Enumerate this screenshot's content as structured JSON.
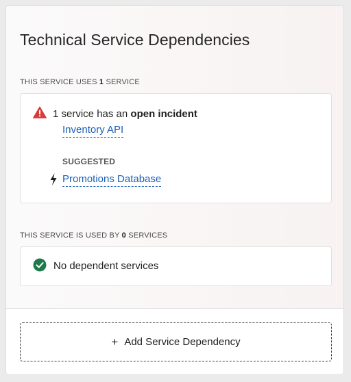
{
  "card": {
    "title": "Technical Service Dependencies"
  },
  "uses_section": {
    "label_prefix": "THIS SERVICE USES ",
    "count": "1",
    "label_suffix": " SERVICE",
    "incident_prefix": "1 service has an ",
    "incident_emphasis": "open incident",
    "incident_service": "Inventory API",
    "suggested_label": "SUGGESTED",
    "suggested_service": "Promotions Database",
    "icons": {
      "warning": "warning-triangle-icon",
      "suggested": "lightning-bolt-icon"
    },
    "colors": {
      "warning": "#d93a3a",
      "link": "#1b5fb8"
    }
  },
  "used_by_section": {
    "label_prefix": "THIS SERVICE IS USED BY ",
    "count": "0",
    "label_suffix": " SERVICES",
    "status_text": "No dependent services",
    "icons": {
      "status": "check-circle-icon"
    },
    "colors": {
      "ok": "#1f7a4a"
    }
  },
  "footer": {
    "add_button_label": "Add Service Dependency",
    "add_button_icon": "plus-icon"
  }
}
